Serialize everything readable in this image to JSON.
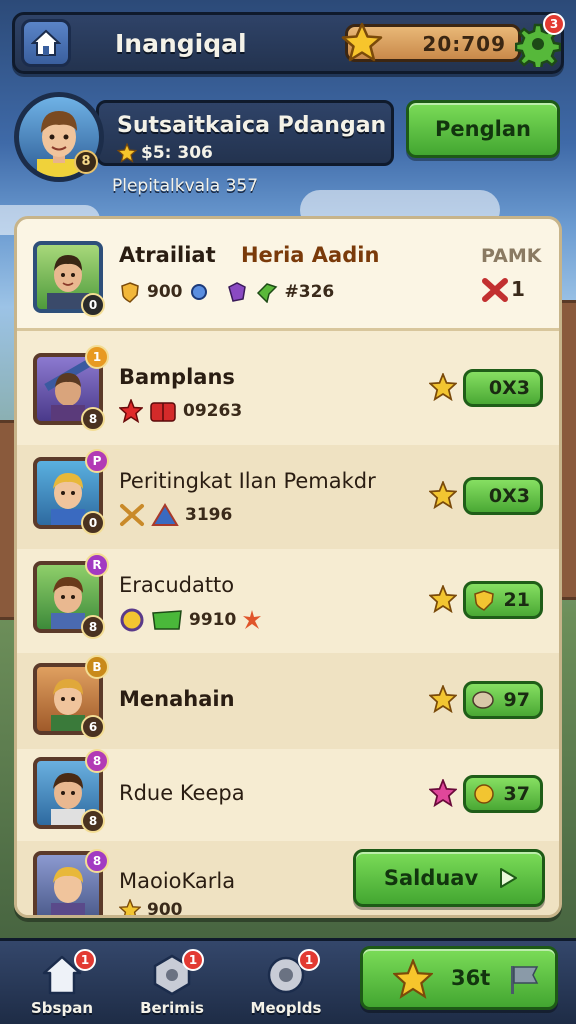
{
  "topbar": {
    "title": "Inangiqal",
    "currency_value": "20:709",
    "gear_badge": "3"
  },
  "profile": {
    "name": "Sutsaitkaica Pdangan",
    "score": "$5: 306",
    "subtitle": "Plepitalkvala 357",
    "level": "8",
    "action_label": "Penglan"
  },
  "leaderboard": {
    "header": {
      "name": "Atrailiat",
      "highlight": "Heria Aadin",
      "score": "900",
      "points": "#326",
      "rank_label": "PAMK",
      "rank_value": "1",
      "level": "0"
    },
    "rows": [
      {
        "name": "Bamplans",
        "score": "09263",
        "rank": "0X3",
        "level_top": "1",
        "level_bottom": "8",
        "top_color": "#e89a22",
        "star_color": "#f2c531"
      },
      {
        "name": "Peritingkat Ilan Pemakdr",
        "score": "3196",
        "rank": "0X3",
        "level_top": "P",
        "level_bottom": "0",
        "top_color": "#b23ab5",
        "star_color": "#f2c531"
      },
      {
        "name": "Eracudatto",
        "score": "9910",
        "rank": "21",
        "level_top": "R",
        "level_bottom": "8",
        "top_color": "#a23ac2",
        "star_color": "#f2c531"
      },
      {
        "name": "Menahain",
        "score": "",
        "rank": "97",
        "level_top": "B",
        "level_bottom": "6",
        "top_color": "#c98a1a",
        "star_color": "#f2c531"
      },
      {
        "name": "Rdue Keepa",
        "score": "",
        "rank": "37",
        "level_top": "8",
        "level_bottom": "8",
        "top_color": "#b23ab5",
        "star_color": "#e0479a"
      },
      {
        "name": "MaoioKarla",
        "score": "900",
        "rank": "",
        "level_top": "8",
        "level_bottom": "",
        "top_color": "#a23ac2",
        "star_color": "#f2c531"
      }
    ],
    "claim_label": "Salduav"
  },
  "nav": {
    "items": [
      {
        "label": "Sbspan",
        "badge": "1"
      },
      {
        "label": "Berimis",
        "badge": "1"
      },
      {
        "label": "Meoplds",
        "badge": "1"
      }
    ],
    "big_button_label": "36t"
  },
  "colors": {
    "accent_green": "#4aa834",
    "panel_bg": "#f6ecd2",
    "bar_navy": "#23334f",
    "gold": "#f2c531"
  }
}
